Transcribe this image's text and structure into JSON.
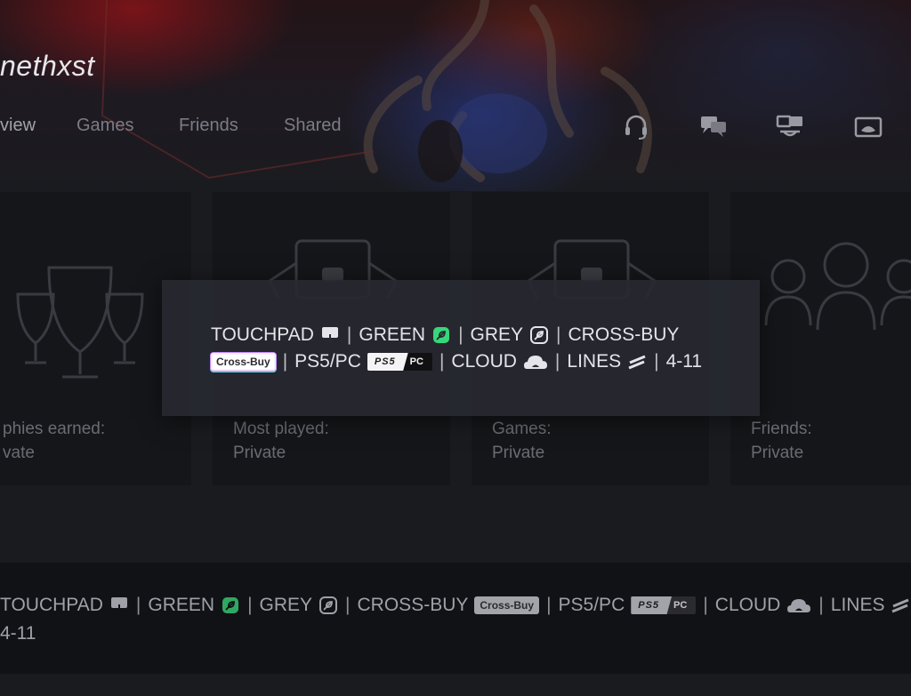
{
  "profile": {
    "username": "nethxst"
  },
  "tabs": [
    {
      "label": "view",
      "active": true
    },
    {
      "label": "Games",
      "active": false
    },
    {
      "label": "Friends",
      "active": false
    },
    {
      "label": "Shared",
      "active": false
    }
  ],
  "actions": [
    "headset-icon",
    "chat-icon",
    "share-screen-icon",
    "controller-icon"
  ],
  "cards": [
    {
      "label": "phies earned:",
      "value": "vate",
      "icon": "trophy-icon"
    },
    {
      "label": "Most played:",
      "value": "Private",
      "icon": "game-card-icon"
    },
    {
      "label": "Games:",
      "value": "Private",
      "icon": "game-library-icon"
    },
    {
      "label": "Friends:",
      "value": "Private",
      "icon": "friends-icon"
    }
  ],
  "overlay": {
    "touchpad": "TOUCHPAD",
    "green": "GREEN",
    "grey": "GREY",
    "crossbuy": "CROSS-BUY",
    "crossbuy_badge": "Cross-Buy",
    "ps5pc": "PS5/PC",
    "ps5_badge": "PS5",
    "pc_badge": "PC",
    "cloud": "CLOUD",
    "lines": "LINES",
    "range": "4-11"
  },
  "strip": {
    "touchpad": "TOUCHPAD",
    "green": "GREEN",
    "grey": "GREY",
    "crossbuy": "CROSS-BUY",
    "crossbuy_badge": "Cross-Buy",
    "ps5pc": "PS5/PC",
    "ps5_badge": "PS5",
    "pc_badge": "PC",
    "cloud": "CLOUD",
    "lines": "LINES",
    "range": "4-11"
  },
  "colors": {
    "green_accent": "#37d67a",
    "card_bg": "#151619",
    "overlay_bg": "#282930"
  },
  "separator": "|"
}
